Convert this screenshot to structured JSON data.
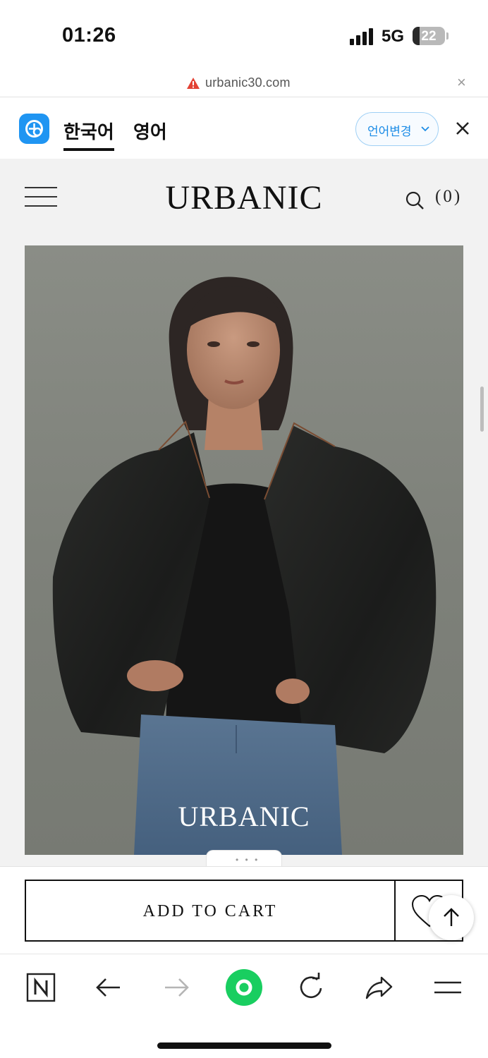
{
  "status_bar": {
    "time": "01:26",
    "network": "5G",
    "battery": "22",
    "battery_level": 0.22
  },
  "url_bar": {
    "url": "urbanic30.com",
    "close_glyph": "×",
    "warning_icon": "warning-triangle-icon"
  },
  "translation_bar": {
    "tabs": [
      {
        "label": "한국어",
        "selected": true
      },
      {
        "label": "영어",
        "selected": false
      }
    ],
    "change_language_label": "언어변경",
    "accent_color": "#1f95f2"
  },
  "header": {
    "logo": "URBANIC",
    "cart_count": "(0)",
    "menu_icon": "hamburger-icon",
    "search_icon": "search-icon"
  },
  "product": {
    "image_watermark": "URBANIC"
  },
  "actions": {
    "add_to_cart_label": "ADD TO CART",
    "wishlist_icon": "heart-icon",
    "scroll_top_icon": "arrow-up-icon"
  },
  "toolbar": {
    "items": [
      "naver-n-icon",
      "back-arrow-icon",
      "forward-arrow-icon",
      "green-home-icon",
      "reload-icon",
      "share-icon",
      "menu-icon"
    ],
    "green_color": "#19ce60"
  }
}
